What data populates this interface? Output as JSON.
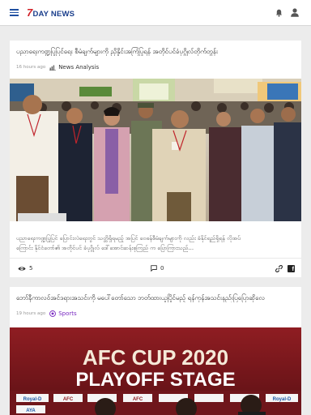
{
  "app": {
    "logo": {
      "num": "7",
      "day": "DAY",
      "news": " NEWS"
    },
    "colors": {
      "brand_blue": "#1a3e8c",
      "brand_red": "#d11f26",
      "accent_purple": "#7a2bc2"
    }
  },
  "feed": [
    {
      "title": "ပညာရေးကဏ္ဍပြုပြင်ရေး စီမံချက်များကို ညှိနှိုင်းအကြံပြုရန် အတိုင်ပင်ခံပုဂ္ဂိုလ်တိုက်တွန်း",
      "time": "16 hours ago",
      "category": "News Analysis",
      "excerpt": [
        "ပညာရေးကဏ္ဍပြုပြင် ပြောင်းလဲရေးတွင် သတ္တိရှိရမည့် အပြင် ဝေဖန်စီမံချက်များကို လည်း ခံနိုင်ရည်ရှိရန် လိုအပ်",
        "ကြောင်း နိုင်ငံတော်၏ အတိုင်ပင် ခံပုဂ္ဂိုလ် ဒေါ်အောင်ဆန်းစုကြည် က ပြောကြားသည်..."
      ],
      "views": "5",
      "comments": "0"
    },
    {
      "title": "ဘော်နီကာလဝ်အင်ဒရားအသင်းကို မပေါ်တော်သော ဘတ်ထားယူပြိုင်မည့် ရန်ကုန်အသင်းနည်းပြပြောဆိုလေ",
      "time": "19 hours ago",
      "category": "Sports",
      "banner": [
        "AFC CUP 2020",
        "PLAYOFF STAGE"
      ],
      "sponsors": [
        "Royal-D",
        "AFC",
        "AFC",
        "Royal-D",
        "AYA"
      ]
    }
  ]
}
